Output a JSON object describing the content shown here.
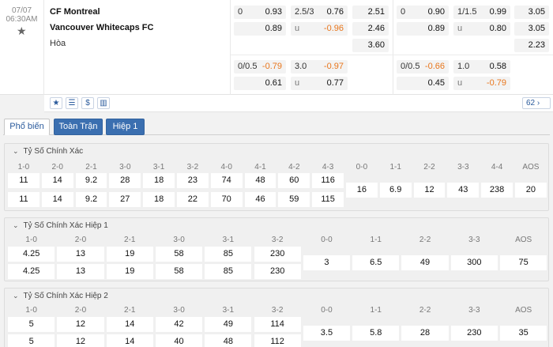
{
  "match": {
    "date": "07/07",
    "time": "06:30AM",
    "home": "CF Montreal",
    "away": "Vancouver Whitecaps FC",
    "draw": "Hòa",
    "odds_count": "62",
    "odds": {
      "a1": {
        "l": "0",
        "r": "0.93"
      },
      "a2": {
        "l": "",
        "r": "0.89"
      },
      "b1": {
        "l": "2.5/3",
        "r": "0.76"
      },
      "b2": {
        "l": "u",
        "r": "-0.96"
      },
      "c1": {
        "l": "",
        "r": "2.51"
      },
      "c2": {
        "l": "",
        "r": "2.46"
      },
      "c3": {
        "l": "",
        "r": "3.60"
      },
      "d1": {
        "l": "0",
        "r": "0.90"
      },
      "d2": {
        "l": "",
        "r": "0.89"
      },
      "e1": {
        "l": "1/1.5",
        "r": "0.99"
      },
      "e2": {
        "l": "u",
        "r": "0.80"
      },
      "f1": {
        "l": "",
        "r": "3.05"
      },
      "f2": {
        "l": "",
        "r": "3.05"
      },
      "f3": {
        "l": "",
        "r": "2.23"
      },
      "g1": {
        "l": "0/0.5",
        "r": "-0.79"
      },
      "g2": {
        "l": "",
        "r": "0.61"
      },
      "h1": {
        "l": "3.0",
        "r": "-0.97"
      },
      "h2": {
        "l": "u",
        "r": "0.77"
      },
      "i1": {
        "l": "0/0.5",
        "r": "-0.66"
      },
      "i2": {
        "l": "",
        "r": "0.45"
      },
      "j1": {
        "l": "1.0",
        "r": "0.58"
      },
      "j2": {
        "l": "u",
        "r": "-0.79"
      }
    }
  },
  "tabs": [
    "Phổ biến",
    "Toàn Trận",
    "Hiệp 1"
  ],
  "sections": [
    {
      "title": "Tỷ Số Chính Xác",
      "headers": [
        "1-0",
        "2-0",
        "2-1",
        "3-0",
        "3-1",
        "3-2",
        "4-0",
        "4-1",
        "4-2",
        "4-3",
        "0-0",
        "1-1",
        "2-2",
        "3-3",
        "4-4",
        "AOS"
      ],
      "row1": [
        "11",
        "14",
        "9.2",
        "28",
        "18",
        "23",
        "74",
        "48",
        "60",
        "116"
      ],
      "row2": [
        "11",
        "14",
        "9.2",
        "27",
        "18",
        "22",
        "70",
        "46",
        "59",
        "115"
      ],
      "mid": [
        "16",
        "6.9",
        "12",
        "43",
        "238",
        "20"
      ]
    },
    {
      "title": "Tỷ Số Chính Xác Hiệp 1",
      "headers": [
        "1-0",
        "2-0",
        "2-1",
        "3-0",
        "3-1",
        "3-2",
        "0-0",
        "1-1",
        "2-2",
        "3-3",
        "AOS"
      ],
      "row1": [
        "4.25",
        "13",
        "19",
        "58",
        "85",
        "230"
      ],
      "row2": [
        "4.25",
        "13",
        "19",
        "58",
        "85",
        "230"
      ],
      "mid": [
        "3",
        "6.5",
        "49",
        "300",
        "75"
      ]
    },
    {
      "title": "Tỷ Số Chính Xác Hiệp 2",
      "headers": [
        "1-0",
        "2-0",
        "2-1",
        "3-0",
        "3-1",
        "3-2",
        "0-0",
        "1-1",
        "2-2",
        "3-3",
        "AOS"
      ],
      "row1": [
        "5",
        "12",
        "14",
        "42",
        "49",
        "114"
      ],
      "row2": [
        "5",
        "12",
        "14",
        "40",
        "48",
        "112"
      ],
      "mid": [
        "3.5",
        "5.8",
        "28",
        "230",
        "35"
      ]
    }
  ],
  "colors": {
    "accent": "#3b6fb0",
    "negative": "#e8761c"
  }
}
